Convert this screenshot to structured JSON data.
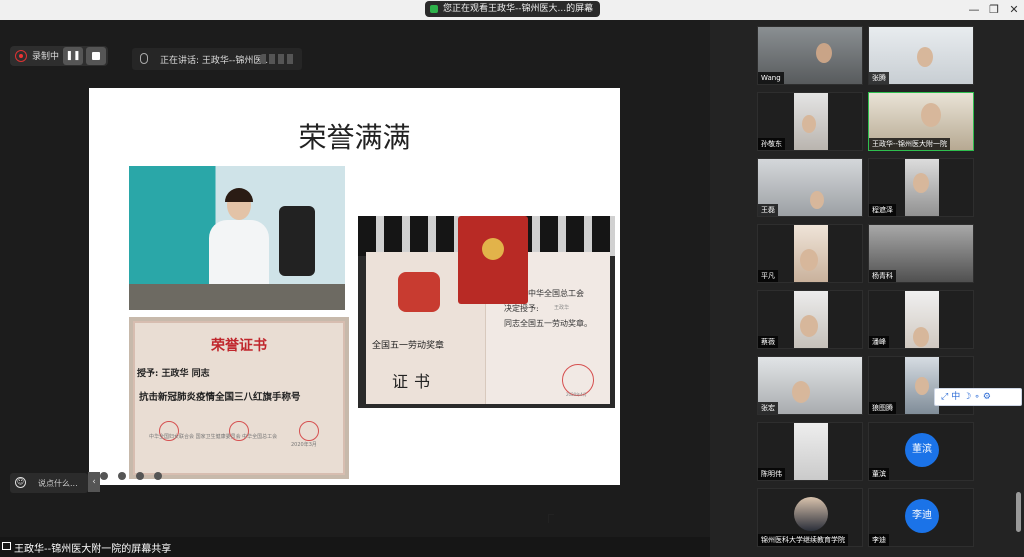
{
  "titlebar": {
    "share_notice": "您正在观看王政华--锦州医大...的屏幕",
    "more_icon": "dots-icon",
    "minimize": "—",
    "restore": "❐",
    "close": "✕"
  },
  "toolbar": {
    "record_label": "录制中",
    "pause": "❚❚",
    "speaking_label": "正在讲话: 王政华--锦州医..."
  },
  "slide": {
    "title": "荣誉满满",
    "cert_red": {
      "title": "荣誉证书",
      "to": "授予: 王政华 同志",
      "honor": "抗击新冠肺炎疫情全国三八红旗手称号",
      "bottom": "中华全国妇女联合会   国家卫生健康委员会   中华全国总工会",
      "year": "2020年3月"
    },
    "medal_cert": {
      "left_title": "全国五一劳动奖章",
      "cert": "证书",
      "org": "中华全国总工会",
      "grant": "决定授予:",
      "name": "王政华",
      "award": "同志全国五一劳动奖章。",
      "date": "2020年4月"
    }
  },
  "chat": {
    "emoji": "☺",
    "placeholder": "说点什么...",
    "toggle": "‹"
  },
  "status": {
    "label": "王政华--锦州医大附一院的屏幕共享"
  },
  "gallery": {
    "participants": [
      {
        "name": "Wang"
      },
      {
        "name": "张腾"
      },
      {
        "name": "孙敬东"
      },
      {
        "name": "王政华--锦州医大附一院"
      },
      {
        "name": "王磊"
      },
      {
        "name": "程遮泽"
      },
      {
        "name": "平凡"
      },
      {
        "name": "杨青科"
      },
      {
        "name": "蔡薇"
      },
      {
        "name": "潘峰"
      },
      {
        "name": "张宏"
      },
      {
        "name": "狼图腾"
      },
      {
        "name": "陈明伟"
      },
      {
        "name": "董滨",
        "avatar": "董滨"
      },
      {
        "name": "锦州医科大学继续教育学院"
      },
      {
        "name": "李迪",
        "avatar": "李迪"
      }
    ],
    "reaction_bar": "⤢中☽∘⚙"
  },
  "colors": {
    "accent_green": "#2fbf4f",
    "avatar_blue": "#1b73e8",
    "record_red": "#e33"
  }
}
